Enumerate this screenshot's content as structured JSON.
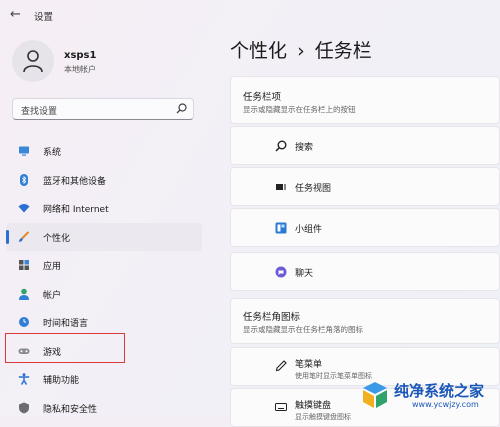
{
  "window": {
    "title": "设置",
    "back_icon": "back-arrow-icon"
  },
  "profile": {
    "name": "xsps1",
    "account_type": "本地帐户"
  },
  "search": {
    "placeholder": "查找设置"
  },
  "sidebar": {
    "items": [
      {
        "label": "系统",
        "icon": "monitor-icon",
        "selected": false
      },
      {
        "label": "蓝牙和其他设备",
        "icon": "bluetooth-icon",
        "selected": false
      },
      {
        "label": "网络和 Internet",
        "icon": "wifi-icon",
        "selected": false
      },
      {
        "label": "个性化",
        "icon": "brush-icon",
        "selected": true
      },
      {
        "label": "应用",
        "icon": "apps-icon",
        "selected": false
      },
      {
        "label": "帐户",
        "icon": "person-icon",
        "selected": false
      },
      {
        "label": "时间和语言",
        "icon": "globe-clock-icon",
        "selected": false
      },
      {
        "label": "游戏",
        "icon": "gamepad-icon",
        "selected": false,
        "highlighted": true
      },
      {
        "label": "辅助功能",
        "icon": "accessibility-icon",
        "selected": false
      },
      {
        "label": "隐私和安全性",
        "icon": "shield-icon",
        "selected": false
      }
    ]
  },
  "main": {
    "breadcrumb_parent": "个性化",
    "separator": "›",
    "breadcrumb_current": "任务栏",
    "section1": {
      "title": "任务栏项",
      "subtitle": "显示或隐藏显示在任务栏上的按钮",
      "items": [
        {
          "label": "搜索",
          "icon": "search-icon"
        },
        {
          "label": "任务视图",
          "icon": "task-view-icon"
        },
        {
          "label": "小组件",
          "icon": "widgets-icon"
        },
        {
          "label": "聊天",
          "icon": "chat-icon"
        }
      ]
    },
    "section2": {
      "title": "任务栏角图标",
      "subtitle": "显示或隐藏显示在任务栏角落的图标",
      "items": [
        {
          "label": "笔菜单",
          "sublabel": "使用笔时显示笔菜单图标",
          "icon": "pen-icon"
        },
        {
          "label": "触摸键盘",
          "sublabel": "显示触摸键盘图标",
          "icon": "keyboard-icon"
        }
      ]
    }
  },
  "watermark": {
    "name": "纯净系统之家",
    "url": "www.ycwjzy.com"
  },
  "colors": {
    "accent": "#2a6fd1",
    "highlight_box": "#d83a3a",
    "watermark": "#1a56b8"
  }
}
